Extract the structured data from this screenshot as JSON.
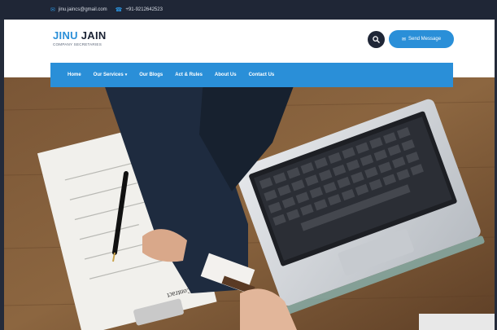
{
  "topbar": {
    "email": "jinu.jaincs@gmail.com",
    "phone": "+91-9212642523",
    "email_icon": "envelope-icon",
    "phone_icon": "phone-icon"
  },
  "brand": {
    "name_first": "JINU",
    "name_last": "JAIN",
    "tagline": "COMPANY SECRETARIES"
  },
  "header_actions": {
    "search_icon": "search-icon",
    "send_label": "Send Message",
    "send_icon": "envelope-icon"
  },
  "nav": {
    "items": [
      {
        "label": "Home"
      },
      {
        "label": "Our Services",
        "has_dropdown": true
      },
      {
        "label": "Our Blogs"
      },
      {
        "label": "Act & Rules"
      },
      {
        "label": "About Us"
      },
      {
        "label": "Contact Us"
      }
    ]
  },
  "hero": {
    "document_label": "Contract"
  },
  "colors": {
    "accent": "#2a8fd8",
    "dark": "#1f2636",
    "white": "#ffffff"
  }
}
